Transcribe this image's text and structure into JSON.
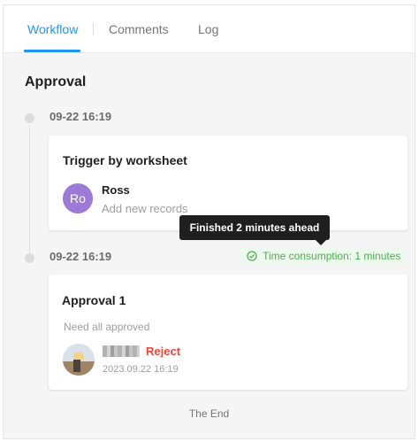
{
  "tabs": [
    {
      "label": "Workflow",
      "active": true
    },
    {
      "label": "Comments",
      "active": false
    },
    {
      "label": "Log",
      "active": false
    }
  ],
  "section_title": "Approval",
  "nodes": [
    {
      "time": "09-22 16:19",
      "card_title": "Trigger by worksheet",
      "person": {
        "initials": "Ro",
        "name": "Ross",
        "action": "Add new records"
      }
    },
    {
      "time": "09-22 16:19",
      "time_badge": "Time consumption: 1 minutes",
      "tooltip": "Finished 2 minutes ahead",
      "card_title": "Approval 1",
      "rule": "Need all approved",
      "approver": {
        "status": "Reject",
        "date": "2023.09.22 16:19"
      }
    }
  ],
  "footer": "The End",
  "colors": {
    "accent": "#2196f3",
    "success": "#4caf50",
    "reject": "#f44336",
    "avatar": "#9e7ad8"
  },
  "icons": {
    "badge_icon": "check-circle-icon",
    "approver_avatar": "user-photo-avatar"
  }
}
